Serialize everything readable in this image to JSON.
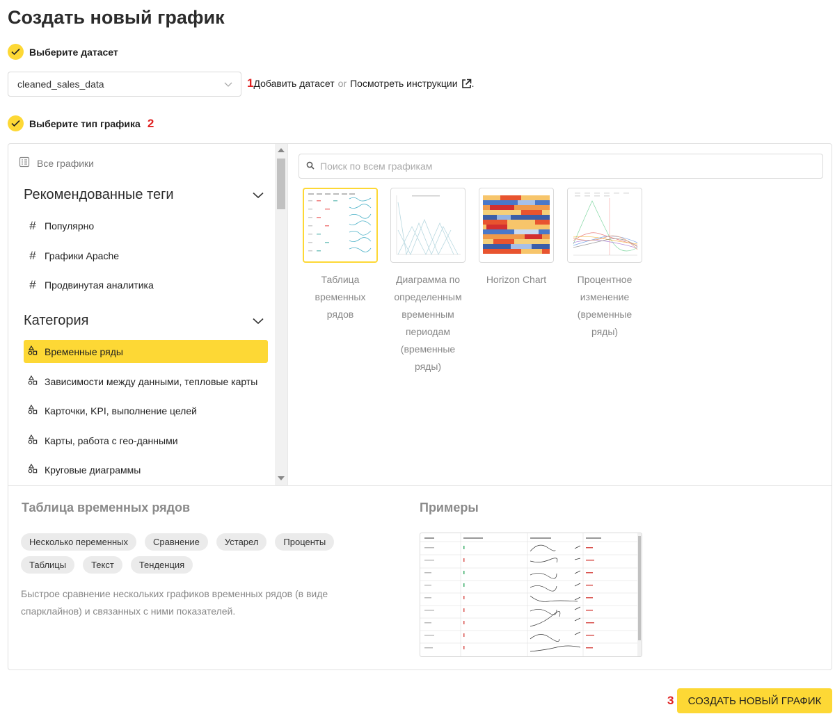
{
  "page": {
    "title": "Создать новый график"
  },
  "steps": {
    "dataset": {
      "label": "Выберите датасет"
    },
    "chart_type": {
      "label": "Выберите тип графика",
      "marker": "2"
    }
  },
  "dataset": {
    "selected": "cleaned_sales_data",
    "marker": "1",
    "add_link": "Добавить датасет",
    "or": "or",
    "instructions_link": "Посмотреть инструкции",
    "trailing": "."
  },
  "sidebar": {
    "all_charts": "Все графики",
    "recommended": {
      "title": "Рекомендованные теги",
      "items": [
        "Популярно",
        "Графики Apache",
        "Продвинутая аналитика"
      ]
    },
    "category": {
      "title": "Категория",
      "items": [
        "Временные ряды",
        "Зависимости между данными, тепловые карты",
        "Карточки, KPI, выполнение целей",
        "Карты, работа с гео-данными",
        "Круговые диаграммы"
      ]
    }
  },
  "search": {
    "placeholder": "Поиск по всем графикам"
  },
  "charts": [
    {
      "label": "Таблица временных рядов"
    },
    {
      "label": "Диаграмма по определенным временным периодам (временные ряды)"
    },
    {
      "label": "Horizon Chart"
    },
    {
      "label": "Процентное изменение (временные ряды)"
    }
  ],
  "details": {
    "title": "Таблица временных рядов",
    "tags": [
      "Несколько переменных",
      "Сравнение",
      "Устарел",
      "Проценты",
      "Таблицы",
      "Текст",
      "Тенденция"
    ],
    "description": "Быстрое сравнение нескольких графиков временных рядов (в виде спарклайнов) и связанных с ними показателей.",
    "examples_title": "Примеры"
  },
  "actions": {
    "create_label": "СОЗДАТЬ НОВЫЙ ГРАФИК",
    "marker": "3"
  },
  "colors": {
    "accent": "#fdd835",
    "marker": "#e02020"
  }
}
